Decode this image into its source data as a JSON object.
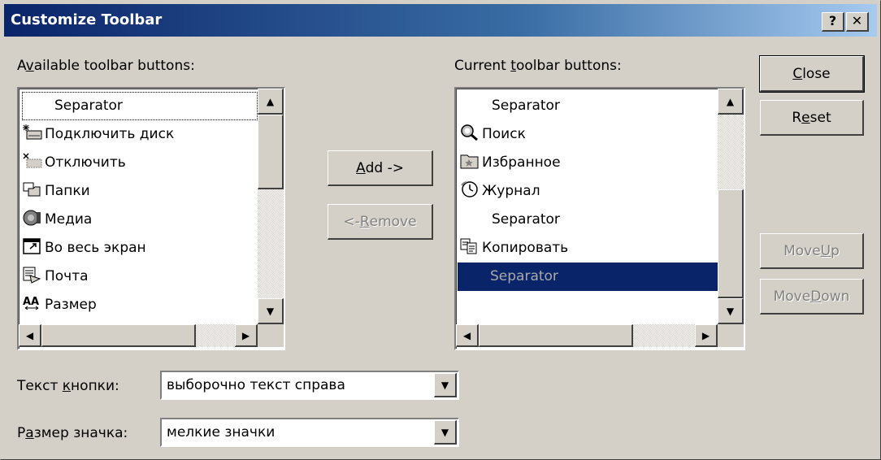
{
  "window": {
    "title": "Customize Toolbar",
    "help_glyph": "?",
    "close_glyph": "✕"
  },
  "available": {
    "label_pre": "A",
    "label_key": "v",
    "label_post": "ailable toolbar buttons:",
    "items": [
      {
        "label": "Separator",
        "icon": ""
      },
      {
        "label": "Подключить диск",
        "icon": "map-drive-icon"
      },
      {
        "label": "Отключить",
        "icon": "disconnect-drive-icon"
      },
      {
        "label": "Папки",
        "icon": "folders-icon"
      },
      {
        "label": "Медиа",
        "icon": "media-icon"
      },
      {
        "label": "Во весь экран",
        "icon": "fullscreen-icon"
      },
      {
        "label": "Почта",
        "icon": "mail-icon"
      },
      {
        "label": "Размер",
        "icon": "font-size-icon"
      }
    ]
  },
  "current": {
    "label_pre": "Current ",
    "label_key": "t",
    "label_post": "oolbar buttons:",
    "items": [
      {
        "label": "Separator",
        "icon": ""
      },
      {
        "label": "Поиск",
        "icon": "search-icon"
      },
      {
        "label": "Избранное",
        "icon": "favorites-icon"
      },
      {
        "label": "Журнал",
        "icon": "history-icon"
      },
      {
        "label": "Separator",
        "icon": ""
      },
      {
        "label": "Копировать",
        "icon": "copy-icon"
      },
      {
        "label": "Separator",
        "icon": ""
      }
    ]
  },
  "buttons": {
    "add": {
      "key": "A",
      "rest": "dd ->"
    },
    "remove": {
      "pre": "<- ",
      "key": "R",
      "rest": "emove"
    },
    "close": {
      "key": "C",
      "rest": "lose"
    },
    "reset": {
      "pre": "R",
      "key": "e",
      "rest": "set"
    },
    "move_up": {
      "pre": "Move ",
      "key": "U",
      "rest": "p"
    },
    "move_down": {
      "pre": "Move ",
      "key": "D",
      "rest": "own"
    }
  },
  "text_options": {
    "label_pre": "Текст ",
    "label_key": "к",
    "label_post": "нопки:",
    "value": "выборочно текст справа"
  },
  "icon_options": {
    "label_pre": "Р",
    "label_key": "а",
    "label_post": "змер значка:",
    "value": "мелкие значки"
  },
  "colors": {
    "title_start": "#0a246a",
    "title_end": "#a6caf0",
    "selection": "#0a246a",
    "face": "#d4d0c8"
  }
}
